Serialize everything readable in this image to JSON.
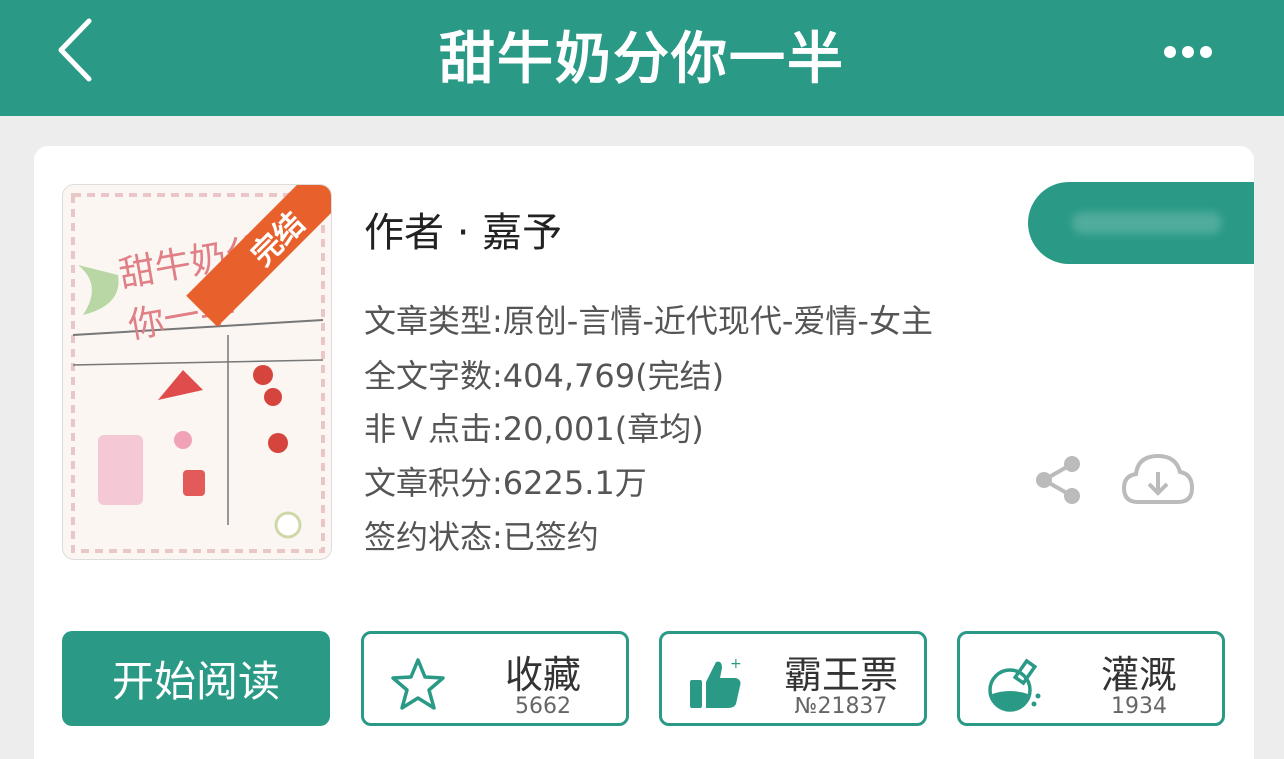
{
  "header": {
    "title": "甜牛奶分你一半",
    "back_icon": "chevron-left-icon",
    "more_icon": "more-dots-icon"
  },
  "book": {
    "cover_title": "甜牛奶分你一半",
    "cover_badge": "完结",
    "author": "作者 · 嘉予",
    "meta": [
      "文章类型:原创-言情-近代现代-爱情-女主",
      "全文字数:404,769(完结)",
      "非Ｖ点击:20,001(章均)",
      "文章积分:6225.1万",
      "签约状态:已签约"
    ]
  },
  "actions": {
    "read_label": "开始阅读",
    "stats": [
      {
        "label": "收藏",
        "count": "5662",
        "icon": "star-icon"
      },
      {
        "label": "霸王票",
        "count": "№21837",
        "icon": "thumbs-up-icon"
      },
      {
        "label": "灌溉",
        "count": "1934",
        "icon": "watering-flask-icon"
      }
    ]
  },
  "colors": {
    "primary": "#2a9a87",
    "ribbon": "#e8612c",
    "background": "#ededed"
  }
}
